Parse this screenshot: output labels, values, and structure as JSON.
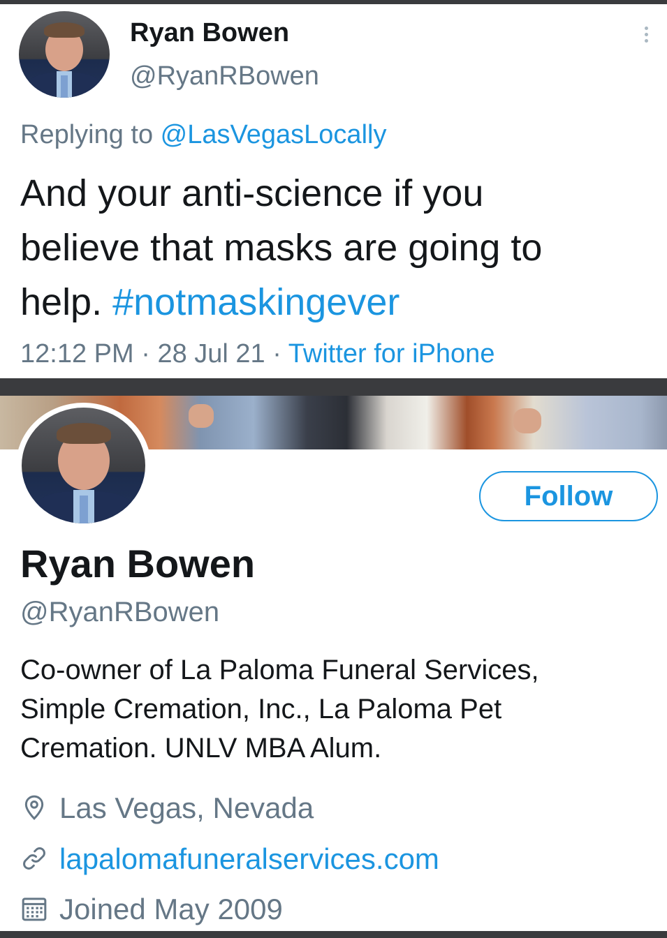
{
  "tweet": {
    "display_name": "Ryan Bowen",
    "handle": "@RyanRBowen",
    "replying_prefix": "Replying to ",
    "replying_to": "@LasVegasLocally",
    "text_line1": "And your anti-science if you",
    "text_line2": "believe that masks are going to",
    "text_line3": "help. ",
    "hashtag": "#notmaskingever",
    "time": "12:12 PM",
    "separator1": " · ",
    "date": "28 Jul 21",
    "separator2": " · ",
    "source": "Twitter for iPhone",
    "menu_icon": "more-vertical-icon"
  },
  "profile": {
    "follow_label": "Follow",
    "display_name": "Ryan Bowen",
    "handle": "@RyanRBowen",
    "bio_line1": "Co-owner of La Paloma Funeral Services,",
    "bio_line2": "Simple Cremation, Inc., La Paloma Pet",
    "bio_line3": "Cremation. UNLV MBA Alum.",
    "location": "Las Vegas, Nevada",
    "website": "lapalomafuneralservices.com",
    "joined": "Joined May 2009",
    "icons": {
      "location": "location-pin-icon",
      "website": "link-icon",
      "joined": "calendar-icon"
    }
  },
  "colors": {
    "link_blue": "#1b95e0",
    "secondary_gray": "#657786",
    "text_dark": "#14171a",
    "frame_dark": "#3a3b3e"
  }
}
